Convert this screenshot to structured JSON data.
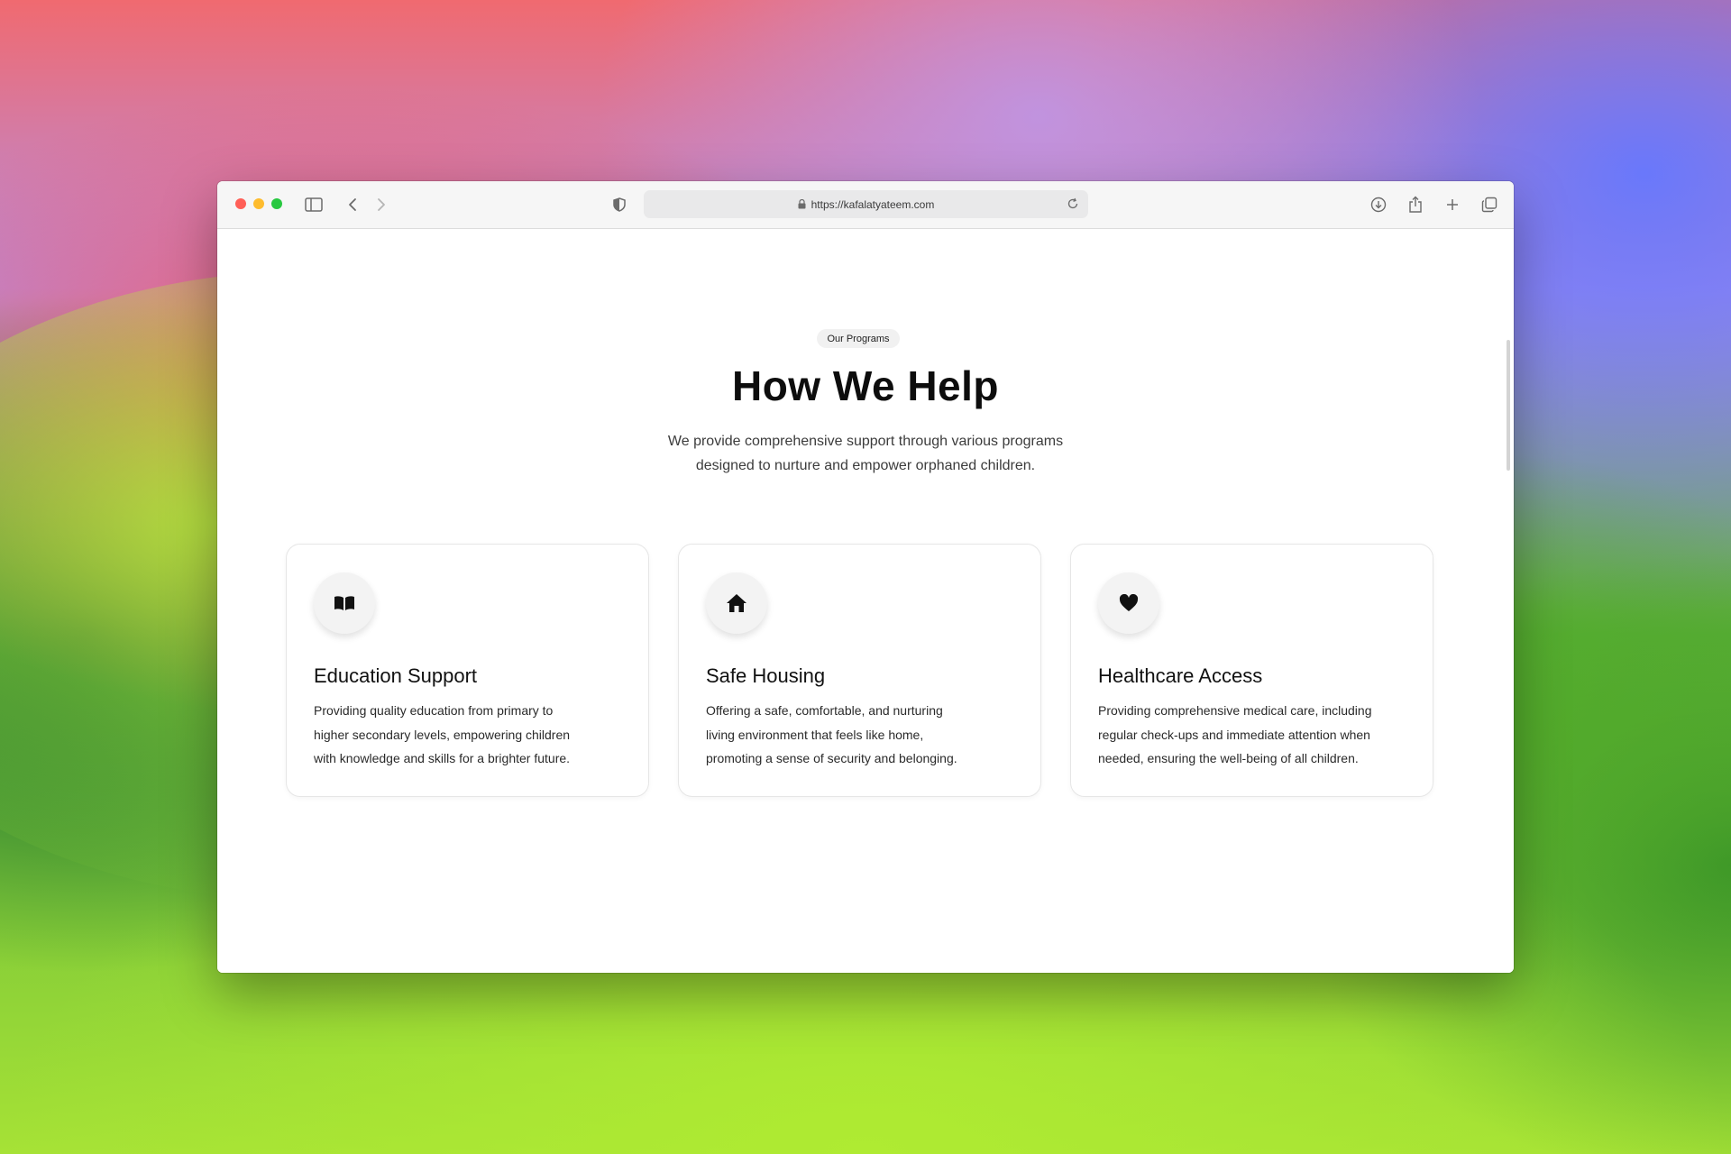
{
  "browser": {
    "url": "https://kafalatyateem.com",
    "icons": [
      "sidebar-icon",
      "back-icon",
      "forward-icon",
      "shield-icon",
      "lock-icon",
      "reload-icon",
      "download-icon",
      "share-icon",
      "new-tab-icon",
      "tabs-overview-icon"
    ]
  },
  "section": {
    "badge": "Our Programs",
    "heading": "How We Help",
    "subtitle_line1": "We provide comprehensive support through various programs",
    "subtitle_line2": "designed to nurture and empower orphaned children."
  },
  "cards": [
    {
      "icon": "book-icon",
      "title": "Education Support",
      "lines": [
        "Providing quality education from primary to",
        "higher secondary levels, empowering children",
        "with knowledge and skills for a brighter future."
      ]
    },
    {
      "icon": "home-icon",
      "title": "Safe Housing",
      "lines": [
        "Offering a safe, comfortable, and nurturing",
        "living environment that feels like home,",
        "promoting a sense of security and belonging."
      ]
    },
    {
      "icon": "heart-icon",
      "title": "Healthcare Access",
      "lines": [
        "Providing comprehensive medical care, including",
        "regular check-ups and immediate attention when",
        "needed, ensuring the well-being of all children."
      ]
    }
  ],
  "colors": {
    "close": "#ff5f57",
    "minimize": "#febc2e",
    "zoom": "#28c840",
    "text": "#111111"
  }
}
